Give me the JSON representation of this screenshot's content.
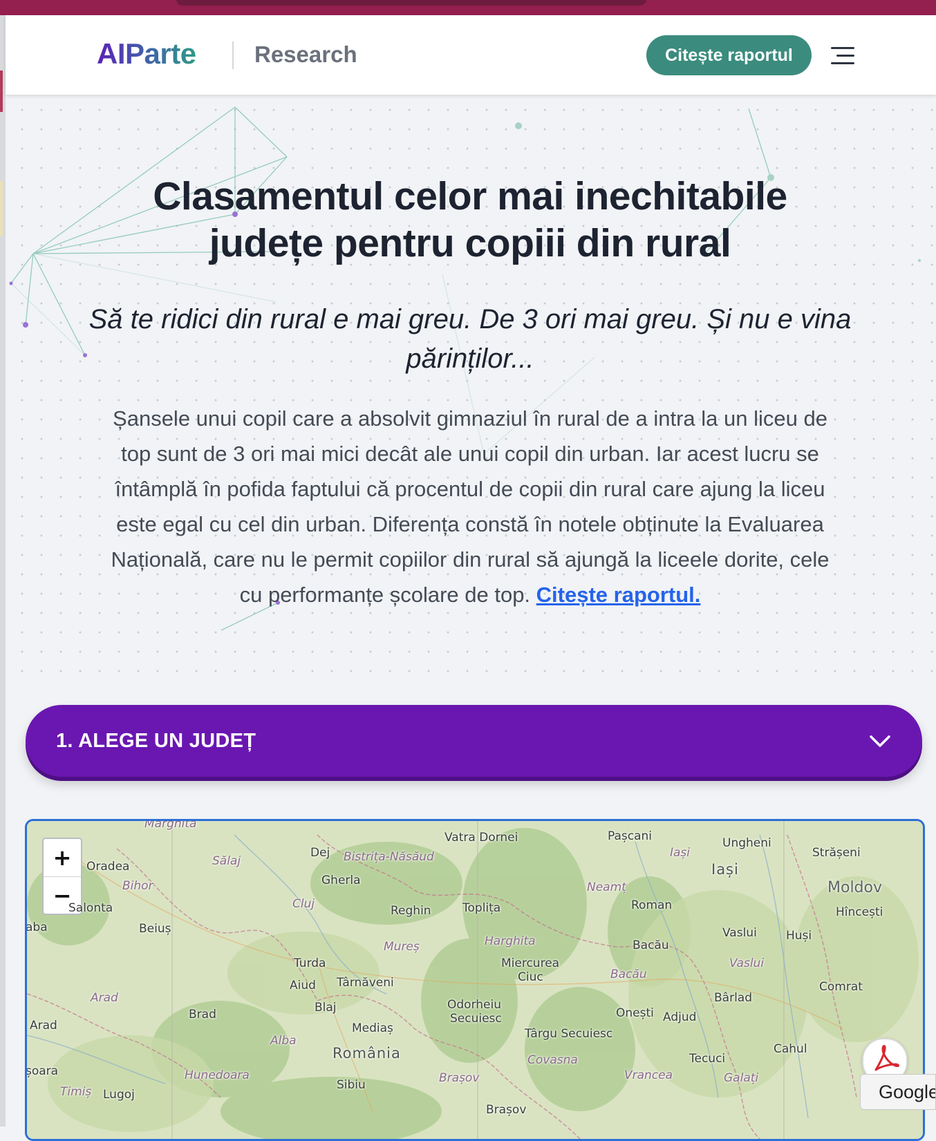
{
  "header": {
    "logo": "AIParte",
    "section": "Research",
    "cta_label": "Citește raportul",
    "menu_icon": "hamburger-menu-icon"
  },
  "hero": {
    "title_line1": "Clasamentul celor mai inechitabile",
    "title_line2": "județe pentru copiii din rural",
    "subtitle": "Să te ridici din rural e mai greu. De 3 ori mai greu. Și nu e vina părinților...",
    "intro_text": "Șansele unui copil care a absolvit gimnaziul în rural de a intra la un liceu de top sunt de 3 ori mai mici decât ale unui copil din urban. Iar acest lucru se întâmplă în pofida faptului că procentul de copii din rural care ajung la liceu este egal cu cel din urban. Diferența constă în notele obținute la Evaluarea Națională, care nu le permit copiilor din rural să ajungă la liceele dorite, cele cu performanțe școlare de top.",
    "intro_link": "Citește raportul."
  },
  "step1": {
    "label": "1. ALEGE UN JUDEȚ",
    "icon": "chevron-down-icon"
  },
  "map": {
    "zoom_in": "+",
    "zoom_out": "−",
    "labels": {
      "oradea": "Oradea",
      "bihor": "Bihor",
      "salaj": "Sălaj",
      "dej": "Dej",
      "bistrita": "Bistrița-Năsăud",
      "gherla": "Gherla",
      "vatra_dornei": "Vatra Dornei",
      "pascani": "Pașcani",
      "iasi_county": "Iași",
      "iasi_city": "Iași",
      "ungheni": "Ungheni",
      "straseni": "Strășeni",
      "moldova": "Moldov",
      "hincesti": "Hîncești",
      "neamt": "Neamț",
      "roman": "Roman",
      "vaslui_city": "Vaslui",
      "vaslui_county": "Vaslui",
      "husi": "Huși",
      "bacau_city": "Bacău",
      "bacau_county": "Bacău",
      "comrat": "Comrat",
      "barlad": "Bârlad",
      "onesti": "Onești",
      "adjud": "Adjud",
      "tecuci": "Tecuci",
      "cahul": "Cahul",
      "galati": "Galați",
      "vrancea": "Vrancea",
      "cluj": "Cluj",
      "reghin": "Reghin",
      "toplita": "Toplița",
      "harghita": "Harghita",
      "mures": "Mureș",
      "miercurea": "Miercurea",
      "ciuc": "Ciuc",
      "turda": "Turda",
      "aiud": "Aiud",
      "tarnaveni": "Târnăveni",
      "blaj": "Blaj",
      "odorheiu": "Odorheiu",
      "secuiesc": "Secuiesc",
      "targu_secuiesc": "Târgu Secuiesc",
      "covasna": "Covasna",
      "medias": "Mediaș",
      "romania": "România",
      "brad": "Brad",
      "alba": "Alba",
      "arad_county": "Arad",
      "arad_city": "Arad",
      "beius": "Beiuș",
      "salonta": "Salonta",
      "saba": "aba",
      "hunedoara": "Hunedoara",
      "sibiu": "Sibiu",
      "brasov_county": "Brașov",
      "brasov_city": "Brașov",
      "timis": "Timiș",
      "lugoj": "Lugoj",
      "timisoara": "șoara",
      "marghita": "Marghita"
    }
  },
  "google_tab": "Google",
  "pdf_icon": "pdf-icon",
  "colors": {
    "brand_purple": "#6a17b1",
    "cta_green": "#3b8c7e",
    "link_blue": "#2563eb",
    "browser_strip": "#93204f"
  }
}
